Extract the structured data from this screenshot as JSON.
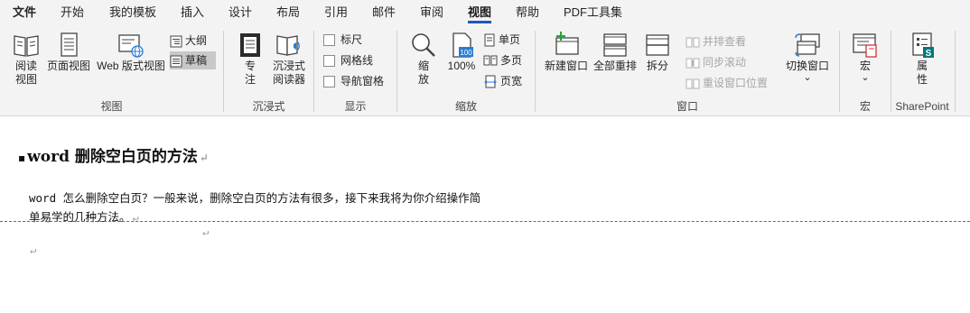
{
  "tabs": [
    {
      "label": "文件"
    },
    {
      "label": "开始"
    },
    {
      "label": "我的模板"
    },
    {
      "label": "插入"
    },
    {
      "label": "设计"
    },
    {
      "label": "布局"
    },
    {
      "label": "引用"
    },
    {
      "label": "邮件"
    },
    {
      "label": "审阅"
    },
    {
      "label": "视图"
    },
    {
      "label": "帮助"
    },
    {
      "label": "PDF工具集"
    }
  ],
  "active_tab": "视图",
  "ribbon": {
    "view_group": {
      "read_mode": "阅读视图",
      "read_mode_l1": "阅读",
      "read_mode_l2": "视图",
      "print_layout": "页面视图",
      "web_layout": "Web 版式视图",
      "outline": "大纲",
      "draft": "草稿",
      "label": "视图"
    },
    "immersive_group": {
      "focus_l1": "专",
      "focus_l2": "注",
      "reader_l1": "沉浸式",
      "reader_l2": "阅读器",
      "label": "沉浸式"
    },
    "show_group": {
      "ruler": "标尺",
      "gridlines": "网格线",
      "nav_pane": "导航窗格",
      "label": "显示"
    },
    "zoom_group": {
      "zoom_l1": "缩",
      "zoom_l2": "放",
      "zoom_100": "100%",
      "zoom_100_icon_text": "100",
      "one_page": "单页",
      "multi_page": "多页",
      "page_width": "页宽",
      "label": "缩放"
    },
    "window_group": {
      "new_window": "新建窗口",
      "arrange_all": "全部重排",
      "split": "拆分",
      "side_by_side": "并排查看",
      "sync_scroll": "同步滚动",
      "reset_pos": "重设窗口位置",
      "switch_windows": "切换窗口",
      "dropdown_arrow": "⌄",
      "label": "窗口"
    },
    "macros_group": {
      "macros": "宏",
      "dropdown_arrow": "⌄",
      "label": "宏"
    },
    "sharepoint_group": {
      "props_l1": "属",
      "props_l2": "性",
      "label": "SharePoint"
    }
  },
  "document": {
    "heading": "word 删除空白页的方法",
    "heading_bullet": "▪",
    "para1_line1": "word 怎么删除空白页？一般来说，删除空白页的方法有很多，接下来我将为你介绍操作简",
    "para1_line2": "单易学的几种方法。",
    "para_mark": "↵"
  },
  "colors": {
    "accent": "#185abd",
    "ribbon_bg": "#f3f3f3",
    "disabled_text": "#a6a6a6"
  }
}
